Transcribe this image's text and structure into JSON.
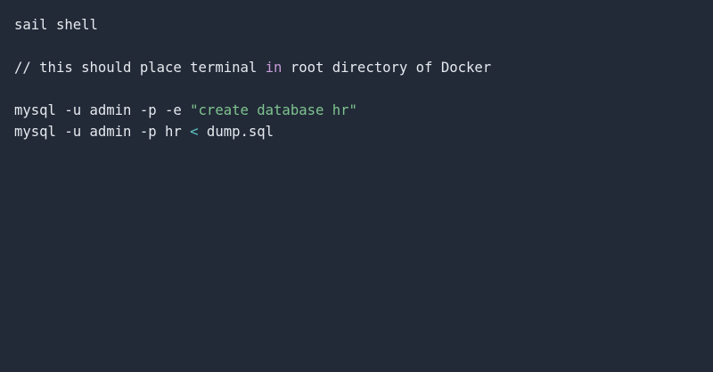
{
  "colors": {
    "background": "#222a38",
    "text": "#e6e9ee",
    "keyword": "#c79bd6",
    "string": "#7fc48f",
    "operator": "#5fc7c7"
  },
  "code": {
    "line1": "sail shell",
    "line3": {
      "before": "// this should place terminal ",
      "keyword": "in",
      "after": " root directory of Docker"
    },
    "line5": {
      "command": "mysql -u admin -p -e ",
      "string": "\"create database hr\""
    },
    "line6": {
      "command": "mysql -u admin -p hr ",
      "operator": "<",
      "after": " dump.sql"
    }
  }
}
